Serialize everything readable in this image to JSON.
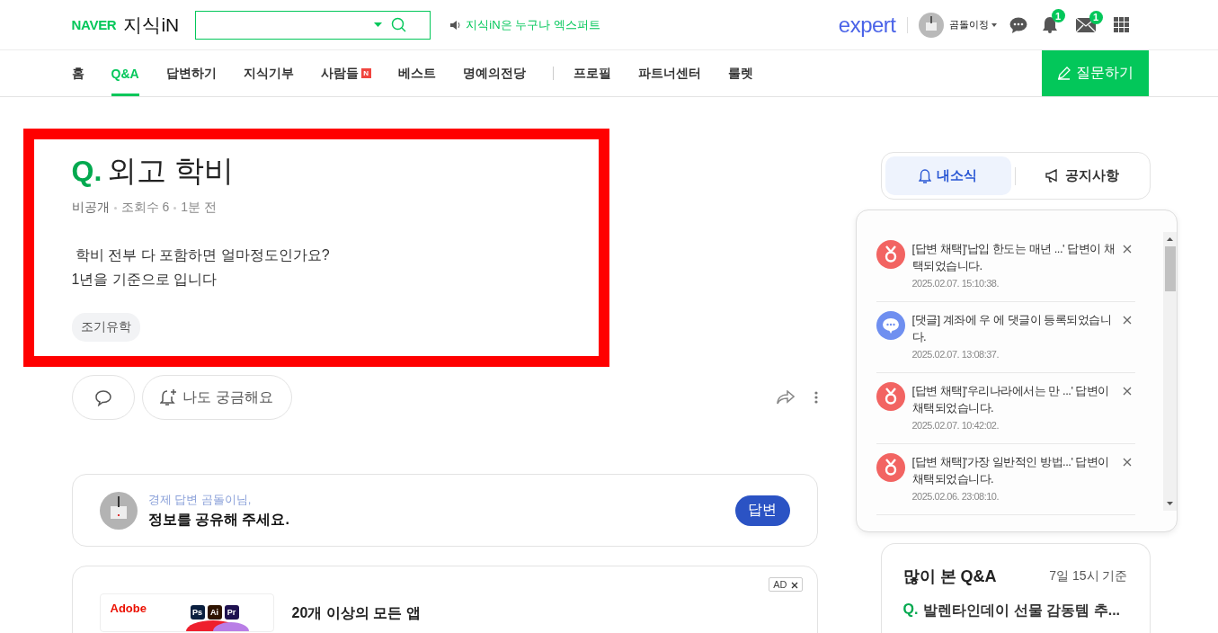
{
  "header": {
    "brand": "NAVER",
    "service": "지식iN",
    "notice": "지식iN은 누구나 엑스퍼트",
    "expert_logo": "expert",
    "user": "곰돌이정",
    "notification_count": "1",
    "mail_count": "1"
  },
  "nav": {
    "groups": [
      [
        {
          "label": "홈",
          "selected": false
        },
        {
          "label": "Q&A",
          "selected": true
        },
        {
          "label": "답변하기",
          "selected": false
        },
        {
          "label": "지식기부",
          "selected": false
        },
        {
          "label": "사람들",
          "selected": false,
          "badge": "N"
        },
        {
          "label": "베스트",
          "selected": false
        },
        {
          "label": "명예의전당",
          "selected": false
        }
      ],
      [
        {
          "label": "프로필",
          "selected": false
        },
        {
          "label": "파트너센터",
          "selected": false
        },
        {
          "label": "룰렛",
          "selected": false
        }
      ]
    ],
    "ask_button": "질문하기"
  },
  "question": {
    "highlighted": true,
    "mark": "Q.",
    "title": "외고 학비",
    "meta": [
      "비공개",
      "조회수 6",
      "1분 전"
    ],
    "body": [
      " 학비 전부 다 포함하면 얼마정도인가요?",
      "1년을 기준으로 입니다"
    ],
    "tags": [
      "조기유학"
    ]
  },
  "actions": {
    "curious": "나도 궁금해요"
  },
  "answer_prompt": {
    "greeting": "경제 답변 곰돌이님,",
    "message": "정보를 공유해 주세요.",
    "button": "답변"
  },
  "ad": {
    "badge": "AD",
    "brand": "Adobe",
    "apps": [
      {
        "label": "Ps",
        "color": "#0a1f3f"
      },
      {
        "label": "Ai",
        "color": "#2f1400"
      },
      {
        "label": "Pr",
        "color": "#1f1250"
      }
    ],
    "headline": "20개 이상의 모든 앱"
  },
  "side_tabs": [
    {
      "label": "내소식",
      "selected": true
    },
    {
      "label": "공지사항",
      "selected": false
    }
  ],
  "notifications": [
    {
      "kind": "adopted",
      "text": "[답변 채택]'납입 한도는 매년 ...' 답변이 채택되었습니다.",
      "time": "2025.02.07. 15:10:38."
    },
    {
      "kind": "comment",
      "text": "[댓글] 계좌에 우 에 댓글이 등록되었습니다.",
      "time": "2025.02.07. 13:08:37."
    },
    {
      "kind": "adopted",
      "text": "[답변 채택]'우리나라에서는 만 ...' 답변이 채택되었습니다.",
      "time": "2025.02.07. 10:42:02."
    },
    {
      "kind": "adopted",
      "text": "[답변 채택]'가장 일반적인 방법...' 답변이 채택되었습니다.",
      "time": "2025.02.06. 23:08:10."
    }
  ],
  "popular": {
    "title": "많이 본 Q&A",
    "basis": "7일 15시 기준",
    "items": [
      {
        "mark": "Q.",
        "title": "발렌타인데이 선물 감동템 추..."
      }
    ]
  }
}
